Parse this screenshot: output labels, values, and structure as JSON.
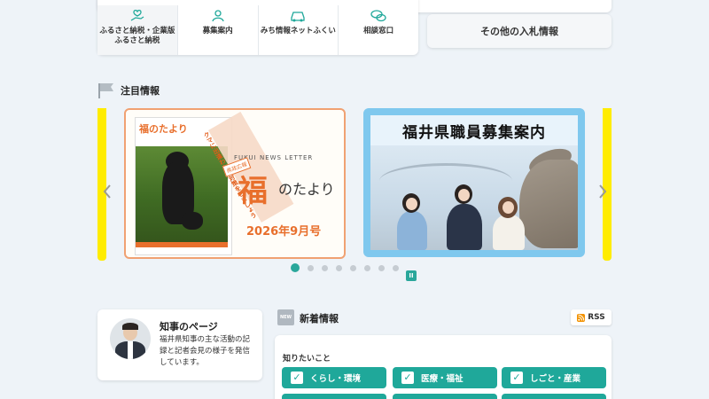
{
  "quick_links": [
    {
      "label": "ふるさと納税・企業版ふるさと納税",
      "icon": "hand-heart-icon"
    },
    {
      "label": "募集案内",
      "icon": "person-icon"
    },
    {
      "label": "みち情報ネットふくい",
      "icon": "car-icon"
    },
    {
      "label": "相談窓口",
      "icon": "chat-icon"
    }
  ],
  "bid_card": {
    "label": "その他の入札情報"
  },
  "featured": {
    "title": "注目情報"
  },
  "carousel": {
    "slide1": {
      "sub": "FUKUI NEWS LETTER",
      "name_big": "福",
      "name_small": "のたより",
      "tag": "県政広報",
      "diag": "クマに出逢わない対策をしましょう",
      "issue": "2026年9月号"
    },
    "slide2": {
      "title": "福井県職員募集案内"
    },
    "dots_count": 8,
    "active_dot": 0
  },
  "governor": {
    "title": "知事のページ",
    "desc": "福井県知事の主な活動の記録と記者会見の様子を発信しています。"
  },
  "news": {
    "badge": "NEW",
    "title": "新着情報",
    "rss": "RSS",
    "want_label": "知りたいこと",
    "categories": [
      "くらし・環境",
      "医療・福祉",
      "しごと・産業"
    ]
  },
  "colors": {
    "accent": "#1fa89a",
    "highlight": "#ffec00",
    "magazine": "#e86f2c"
  }
}
